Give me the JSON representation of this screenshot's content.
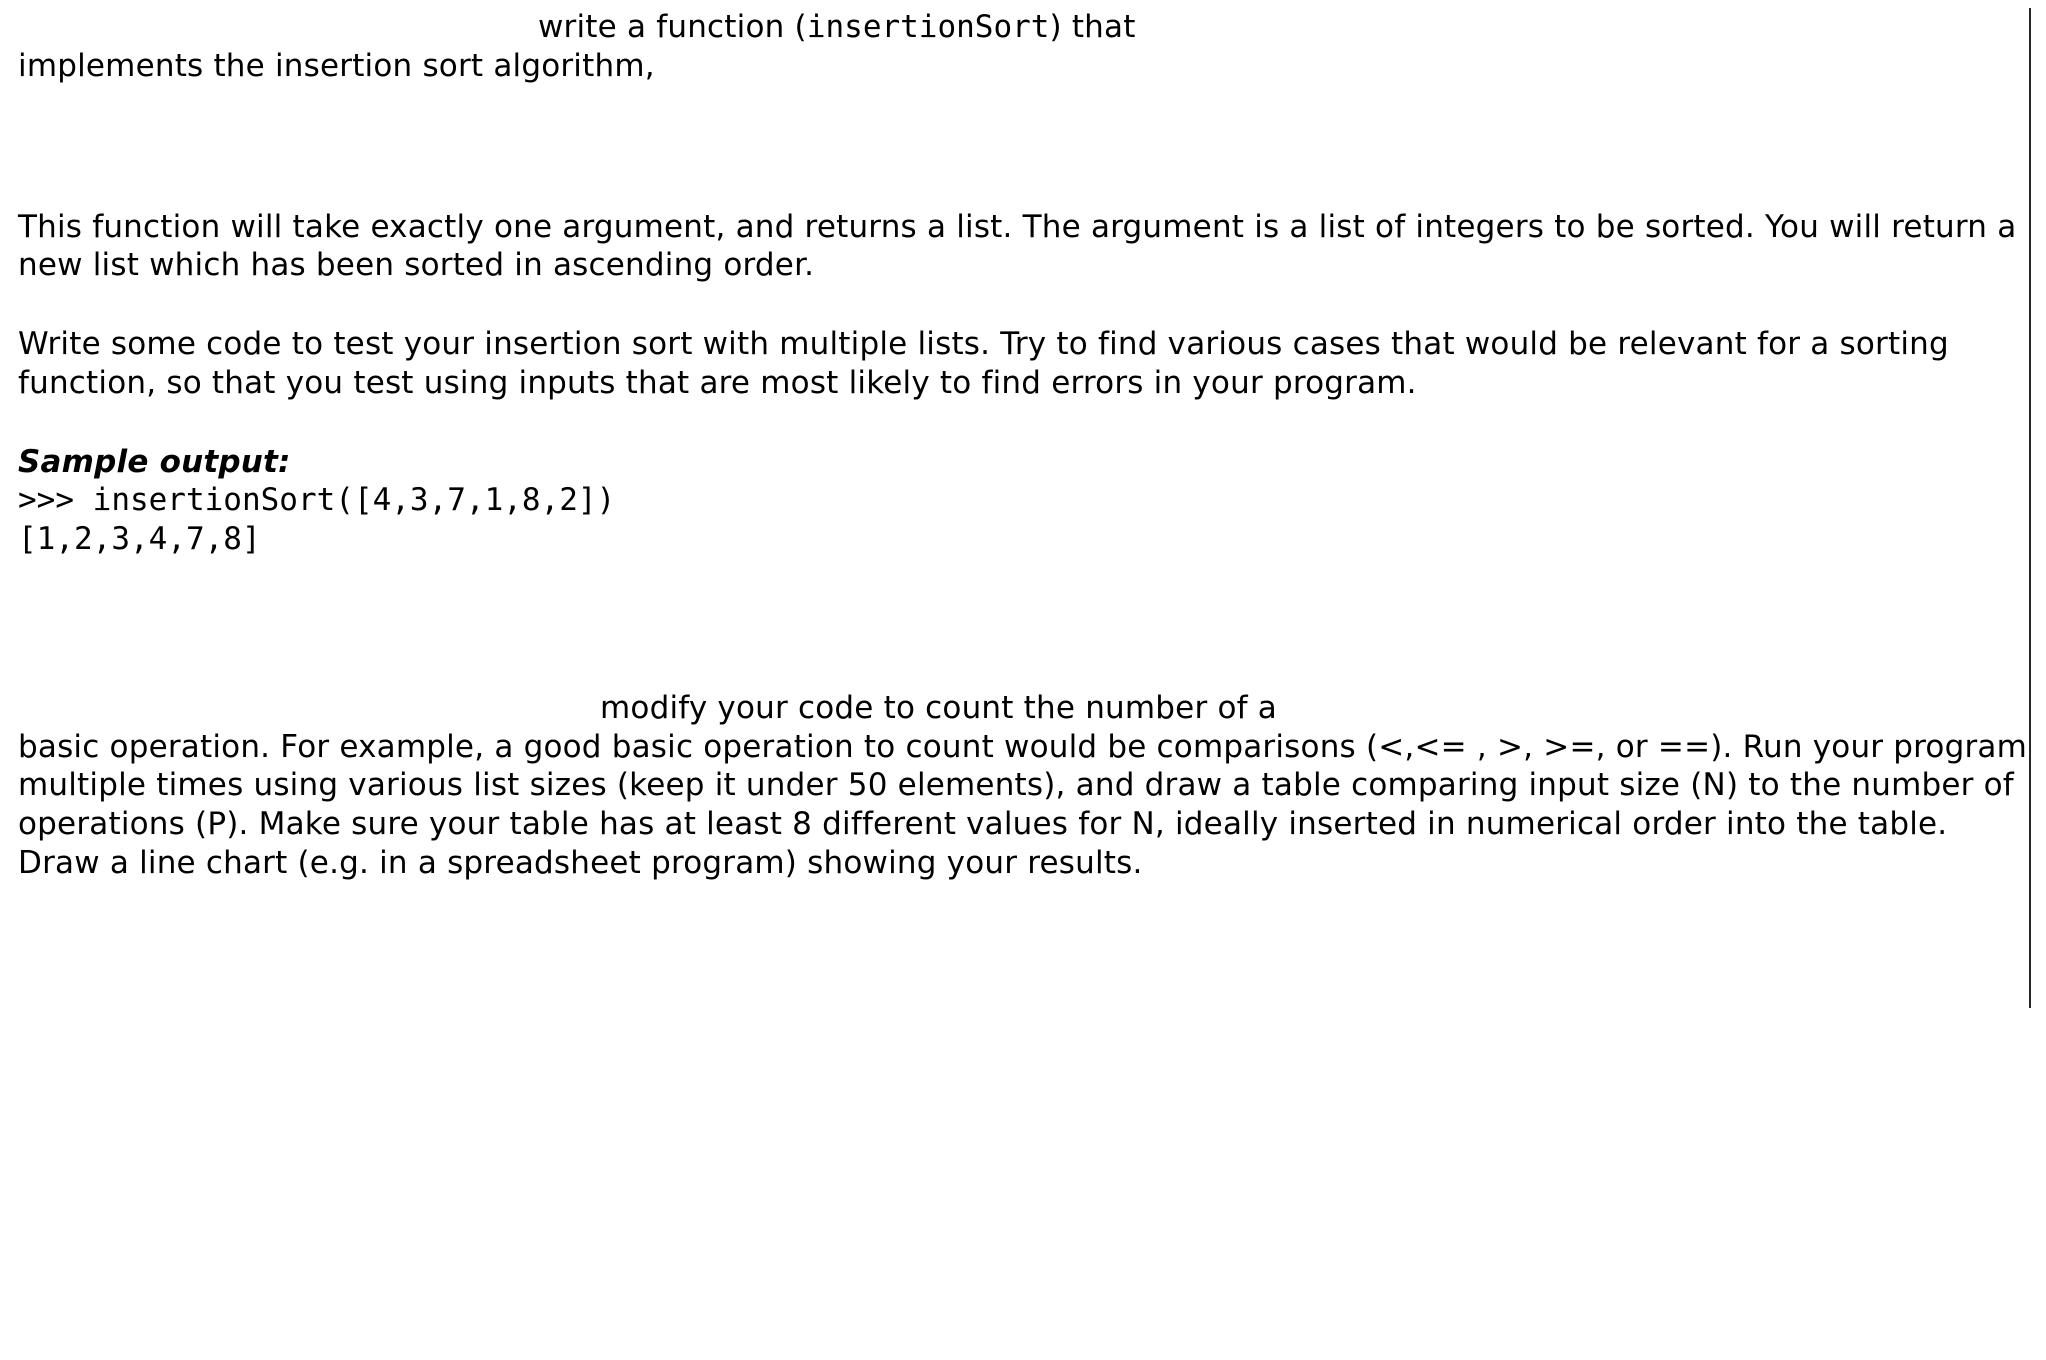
{
  "doc": {
    "p1a_lead_space": "",
    "p1a": "write a function (",
    "p1a_code": "insertionSort",
    "p1a_tail": ") that",
    "p1b": "implements the insertion sort algorithm,",
    "p2": "This function will take exactly one argument, and returns a list.  The argument is a list of integers to be sorted.  You will return a new list which has been sorted in ascending order.",
    "p3": "Write some code to test your insertion sort with multiple lists.  Try to find various cases that would be relevant for a sorting function, so that you test using inputs that are most likely to find errors in your program.",
    "sample_label": "Sample output:",
    "sample_line1": ">>>  insertionSort([4,3,7,1,8,2])",
    "sample_line2": "[1,2,3,4,7,8]",
    "p4a": "modify your code to count the number of a",
    "p4b": "basic operation.  For example, a good basic operation to count would be comparisons (<,<= , >, >=, or ==).  Run your program multiple times using various list sizes (keep it under 50 elements), and draw a table comparing input size (N) to the number of operations (P).  Make sure your table has at least 8 different values for N, ideally inserted in numerical order into the table.  Draw a line chart (e.g. in a spreadsheet program) showing your results."
  }
}
